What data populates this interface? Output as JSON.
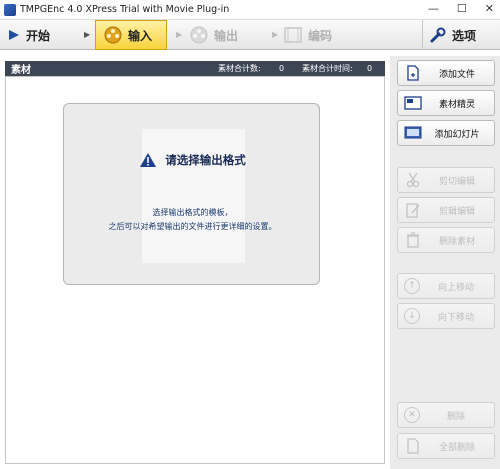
{
  "window": {
    "title": "TMPGEnc 4.0 XPress Trial with Movie Plug-in",
    "minimize": "—",
    "maximize": "☐",
    "close": "✕"
  },
  "toolbar": {
    "start": "开始",
    "input": "输入",
    "output": "输出",
    "encode": "编码",
    "options": "选项"
  },
  "panel": {
    "title": "素材",
    "total_count_label": "素材合计数:",
    "total_count": "0",
    "total_time_label": "素材合计时间:",
    "total_time": "0"
  },
  "message": {
    "title": "请选择输出格式",
    "line1": "选择输出格式的模板，",
    "line2": "之后可以对希望输出的文件进行更详细的设置。"
  },
  "sidebar": {
    "add_file": "添加文件",
    "wizard": "素材精灵",
    "slideshow": "添加幻灯片",
    "cut_edit": "剪切编辑",
    "clip_edit": "剪辑编辑",
    "delete_clip": "删除素材",
    "move_up": "向上移动",
    "move_down": "向下移动",
    "delete": "删除",
    "delete_all": "全部删除"
  }
}
